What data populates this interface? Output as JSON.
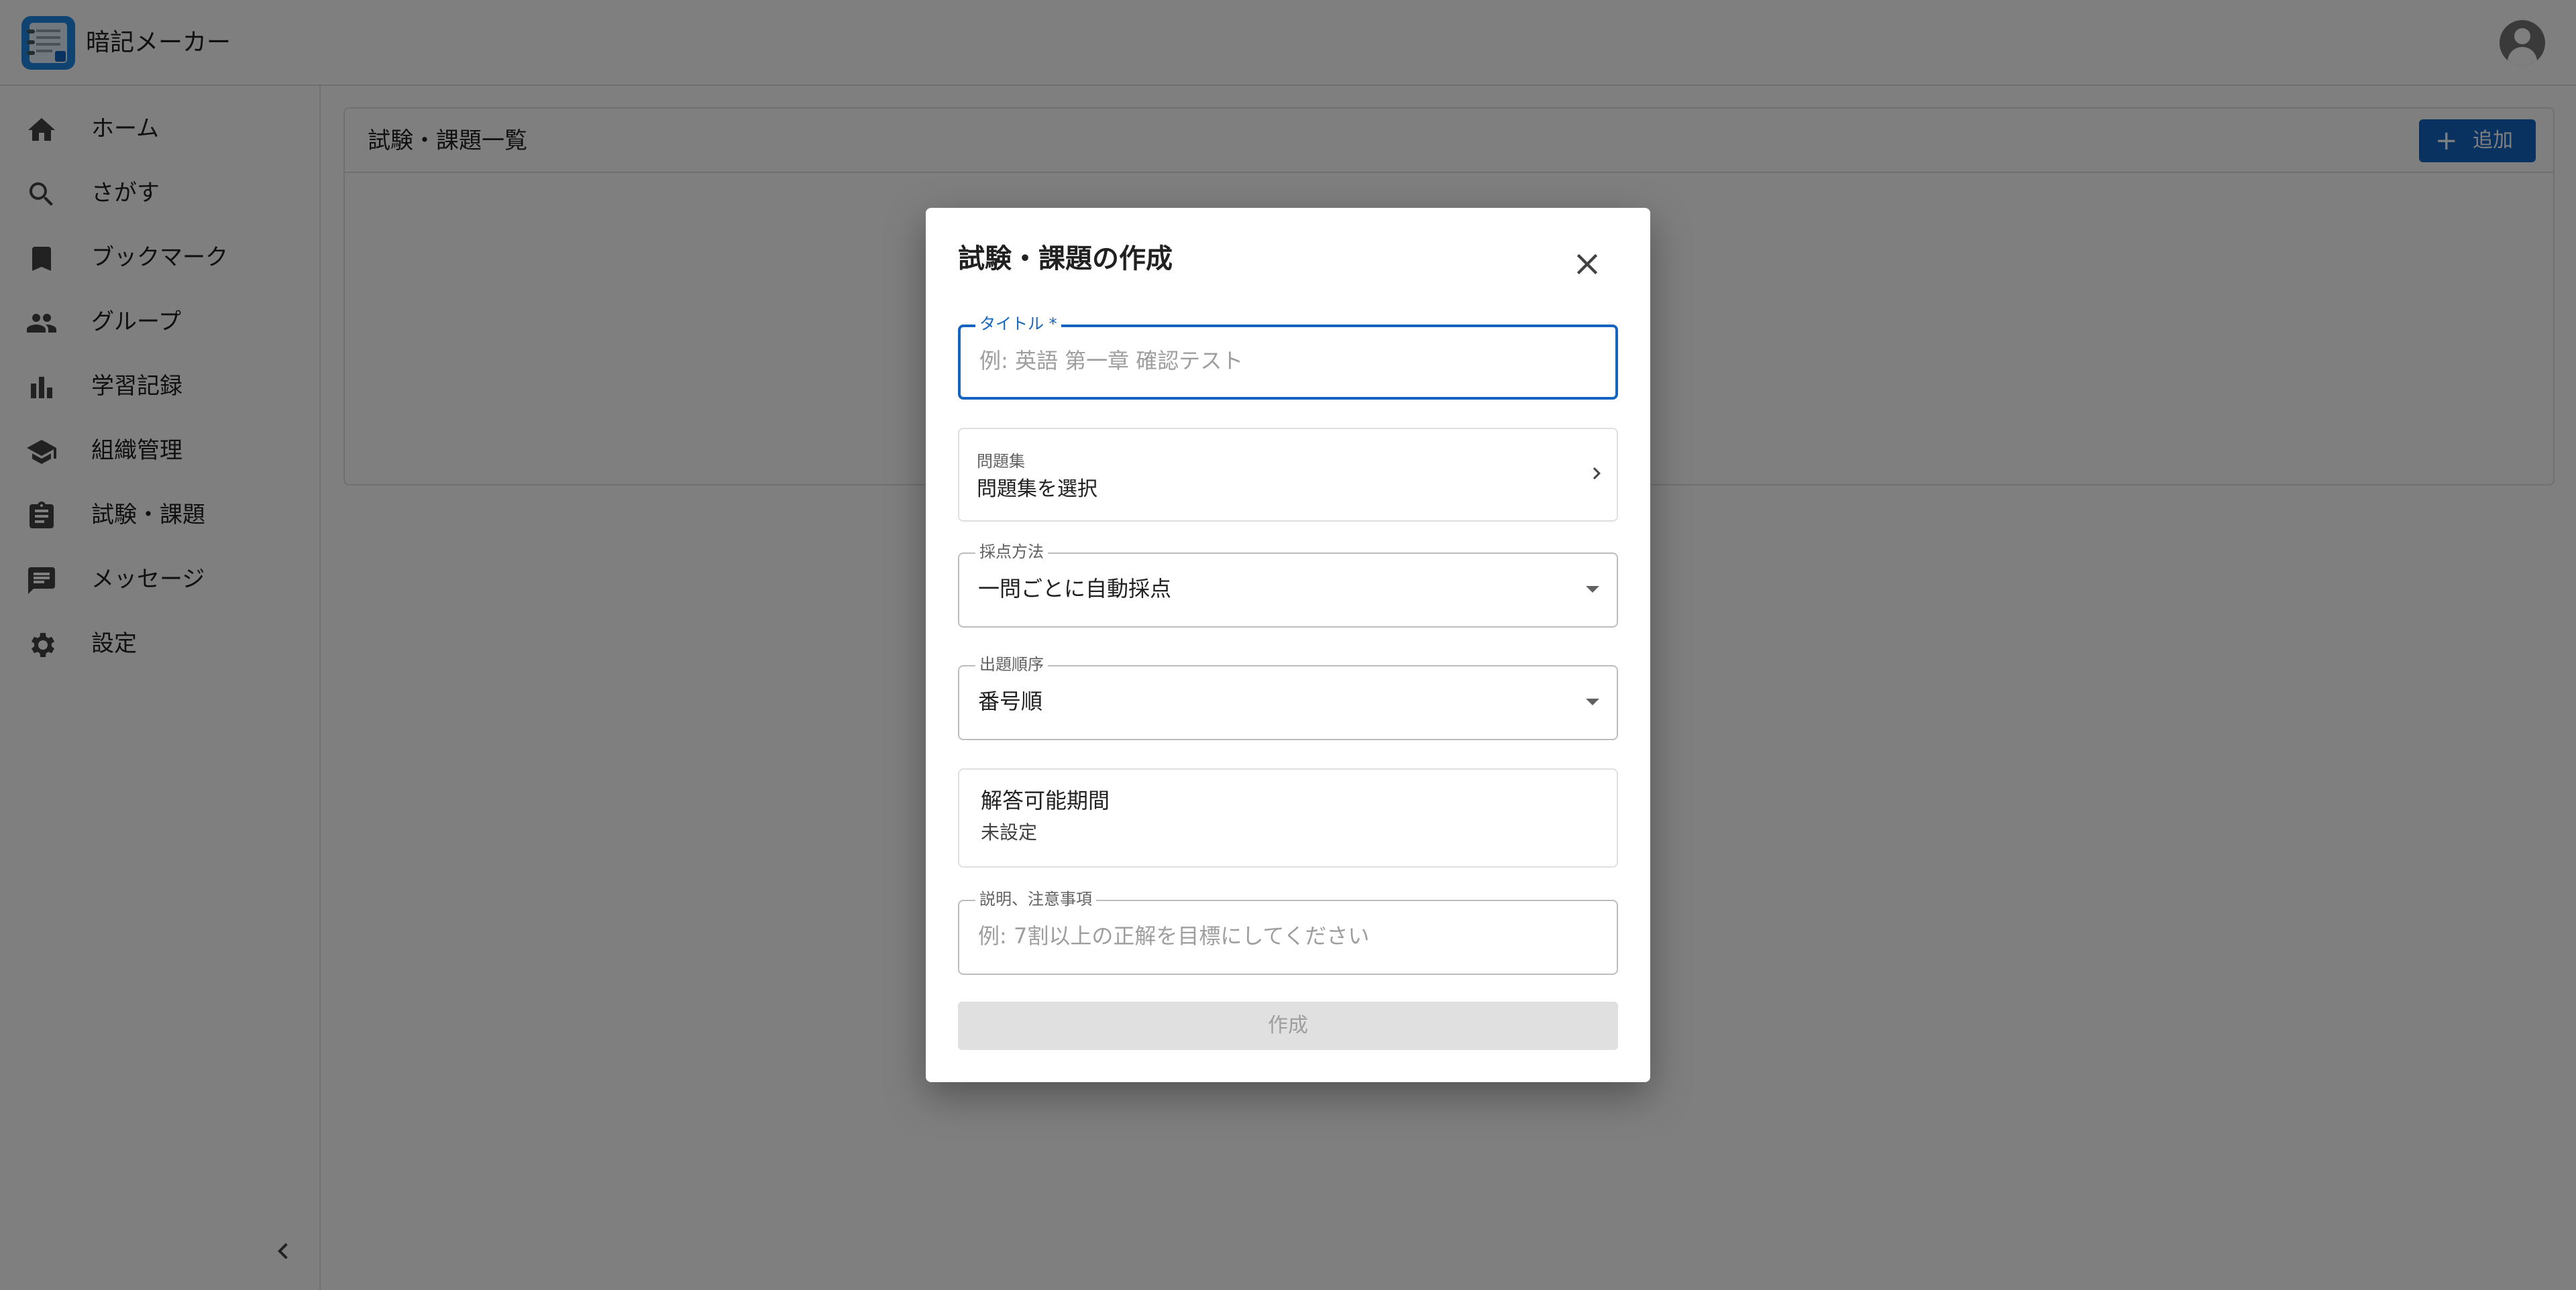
{
  "app": {
    "title": "暗記メーカー"
  },
  "sidebar": {
    "items": [
      {
        "label": "ホーム",
        "icon": "home-icon"
      },
      {
        "label": "さがす",
        "icon": "search-icon"
      },
      {
        "label": "ブックマーク",
        "icon": "bookmark-icon"
      },
      {
        "label": "グループ",
        "icon": "people-icon"
      },
      {
        "label": "学習記録",
        "icon": "bar-chart-icon"
      },
      {
        "label": "組織管理",
        "icon": "school-icon"
      },
      {
        "label": "試験・課題",
        "icon": "assignment-icon"
      },
      {
        "label": "メッセージ",
        "icon": "message-icon"
      },
      {
        "label": "設定",
        "icon": "gear-icon"
      }
    ]
  },
  "main": {
    "card_title": "試験・課題一覧",
    "add_button": "追加"
  },
  "dialog": {
    "title": "試験・課題の作成",
    "title_field": {
      "label": "タイトル *",
      "placeholder": "例: 英語 第一章 確認テスト",
      "value": ""
    },
    "problem_set": {
      "label": "問題集",
      "value": "問題集を選択"
    },
    "scoring": {
      "label": "採点方法",
      "value": "一問ごとに自動採点"
    },
    "order": {
      "label": "出題順序",
      "value": "番号順"
    },
    "period": {
      "label": "解答可能期間",
      "value": "未設定"
    },
    "description": {
      "label": "説明、注意事項",
      "placeholder": "例: 7割以上の正解を目標にしてください",
      "value": ""
    },
    "create_button": "作成"
  },
  "colors": {
    "primary": "#1565c0",
    "overlay": "rgba(0,0,0,0.5)",
    "disabled_bg": "#e0e0e0"
  }
}
